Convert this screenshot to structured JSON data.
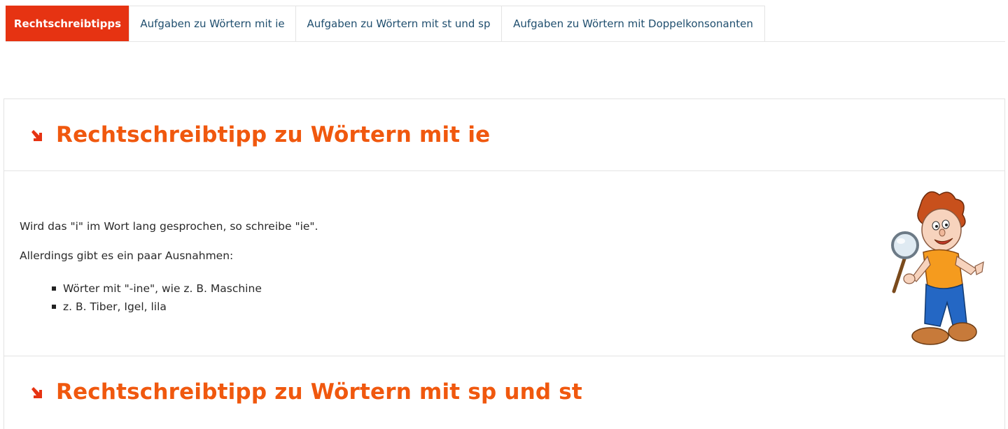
{
  "tabs": [
    {
      "label": "Rechtschreibtipps",
      "active": true
    },
    {
      "label": "Aufgaben zu Wörtern mit ie",
      "active": false
    },
    {
      "label": "Aufgaben zu Wörtern mit st und sp",
      "active": false
    },
    {
      "label": "Aufgaben zu Wörtern mit Doppelkonsonanten",
      "active": false
    }
  ],
  "sections": [
    {
      "heading": "Rechtschreibtipp zu Wörtern mit ie",
      "paragraphs": [
        "Wird das \"i\" im Wort lang gesprochen, so schreibe \"ie\".",
        "Allerdings gibt es ein paar Ausnahmen:"
      ],
      "list": [
        "Wörter mit \"-ine\", wie z. B. Maschine",
        "z. B. Tiber, Igel, lila"
      ],
      "illustration": "boy-with-magnifying-glass"
    },
    {
      "heading": "Rechtschreibtipp zu Wörtern mit sp und st"
    }
  ],
  "colors": {
    "accent": "#e63312",
    "heading": "#f0580e",
    "tab_text": "#1f4e6e"
  }
}
